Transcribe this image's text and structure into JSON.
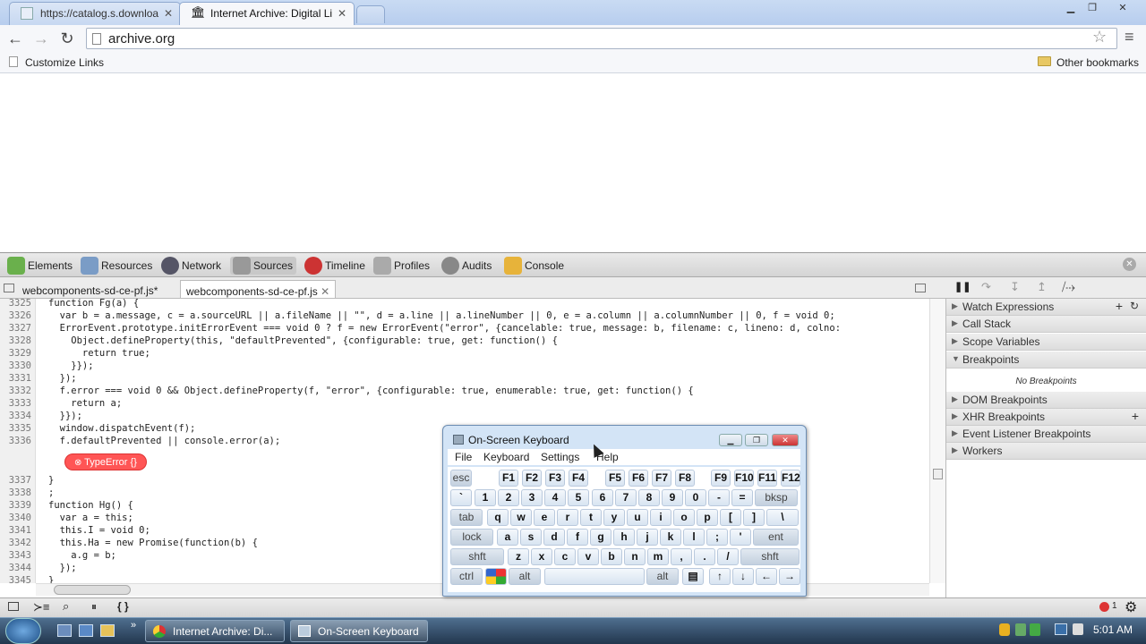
{
  "browser": {
    "tabs": [
      {
        "title": "https://catalog.s.downloa",
        "active": false
      },
      {
        "title": "Internet Archive: Digital Li",
        "active": true
      }
    ],
    "url": "archive.org",
    "bookmarks": {
      "left": "Customize Links",
      "right": "Other bookmarks"
    }
  },
  "devtools": {
    "panels": [
      "Elements",
      "Resources",
      "Network",
      "Sources",
      "Timeline",
      "Profiles",
      "Audits",
      "Console"
    ],
    "active_panel": "Sources",
    "file_tabs": [
      "webcomponents-sd-ce-pf.js*",
      "webcomponents-sd-ce-pf.js"
    ],
    "code_lines": [
      {
        "n": "3325",
        "t": "function Fg(a) {"
      },
      {
        "n": "3326",
        "t": "  var b = a.message, c = a.sourceURL || a.fileName || \"\", d = a.line || a.lineNumber || 0, e = a.column || a.columnNumber || 0, f = void 0;"
      },
      {
        "n": "3327",
        "t": "  ErrorEvent.prototype.initErrorEvent === void 0 ? f = new ErrorEvent(\"error\", {cancelable: true, message: b, filename: c, lineno: d, colno:"
      },
      {
        "n": "3328",
        "t": "    Object.defineProperty(this, \"defaultPrevented\", {configurable: true, get: function() {"
      },
      {
        "n": "3329",
        "t": "      return true;"
      },
      {
        "n": "3330",
        "t": "    }});"
      },
      {
        "n": "3331",
        "t": "  });"
      },
      {
        "n": "3332",
        "t": "  f.error === void 0 && Object.defineProperty(f, \"error\", {configurable: true, enumerable: true, get: function() {"
      },
      {
        "n": "3333",
        "t": "    return a;"
      },
      {
        "n": "3334",
        "t": "  }});"
      },
      {
        "n": "3335",
        "t": "  window.dispatchEvent(f);"
      },
      {
        "n": "3336",
        "t": "  f.defaultPrevented || console.error(a);"
      },
      {
        "n": "3337",
        "t": "}"
      },
      {
        "n": "3338",
        "t": ";"
      },
      {
        "n": "3339",
        "t": "function Hg() {"
      },
      {
        "n": "3340",
        "t": "  var a = this;"
      },
      {
        "n": "3341",
        "t": "  this.I = void 0;"
      },
      {
        "n": "3342",
        "t": "  this.Ha = new Promise(function(b) {"
      },
      {
        "n": "3343",
        "t": "    a.g = b;"
      },
      {
        "n": "3344",
        "t": "  });"
      },
      {
        "n": "3345",
        "t": "}"
      }
    ],
    "error_bubble": "TypeError {}",
    "sidebar": {
      "sections": [
        "Watch Expressions",
        "Call Stack",
        "Scope Variables",
        "Breakpoints",
        "DOM Breakpoints",
        "XHR Breakpoints",
        "Event Listener Breakpoints",
        "Workers"
      ],
      "breakpoints_empty": "No Breakpoints"
    },
    "error_count": "1"
  },
  "osk": {
    "title": "On-Screen Keyboard",
    "menu": [
      "File",
      "Keyboard",
      "Settings",
      "Help"
    ],
    "rows": [
      [
        "esc",
        "F1",
        "F2",
        "F3",
        "F4",
        "F5",
        "F6",
        "F7",
        "F8",
        "F9",
        "F10",
        "F11",
        "F12"
      ],
      [
        "`",
        "1",
        "2",
        "3",
        "4",
        "5",
        "6",
        "7",
        "8",
        "9",
        "0",
        "-",
        "=",
        "bksp"
      ],
      [
        "tab",
        "q",
        "w",
        "e",
        "r",
        "t",
        "y",
        "u",
        "i",
        "o",
        "p",
        "[",
        "]",
        "\\"
      ],
      [
        "lock",
        "a",
        "s",
        "d",
        "f",
        "g",
        "h",
        "j",
        "k",
        "l",
        ";",
        "'",
        "ent"
      ],
      [
        "shft",
        "z",
        "x",
        "c",
        "v",
        "b",
        "n",
        "m",
        ",",
        ".",
        "/",
        "shft"
      ],
      [
        "ctrl",
        "",
        "alt",
        "",
        "alt",
        "",
        "↑",
        "↓",
        "←",
        "→"
      ]
    ]
  },
  "taskbar": {
    "items": [
      "Internet Archive: Di...",
      "On-Screen Keyboard"
    ],
    "time": "5:01 AM"
  }
}
